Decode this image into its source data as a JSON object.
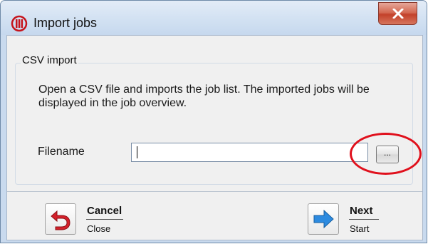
{
  "window": {
    "title": "Import jobs"
  },
  "group": {
    "title": "CSV import",
    "description": "Open a CSV file and imports the job list. The imported jobs will be displayed in the job overview."
  },
  "filename": {
    "label": "Filename",
    "value": "",
    "browse_label": "..."
  },
  "commands": {
    "cancel": {
      "label": "Cancel",
      "sub": "Close"
    },
    "next": {
      "label": "Next",
      "sub": "Start"
    }
  },
  "icons": {
    "app": "app-logo-icon",
    "close": "close-icon",
    "cancel": "undo-arrow-icon",
    "next": "right-arrow-icon"
  },
  "colors": {
    "highlight": "#e0101c",
    "cancel_icon": "#d4202a",
    "next_icon": "#2d8be0"
  }
}
